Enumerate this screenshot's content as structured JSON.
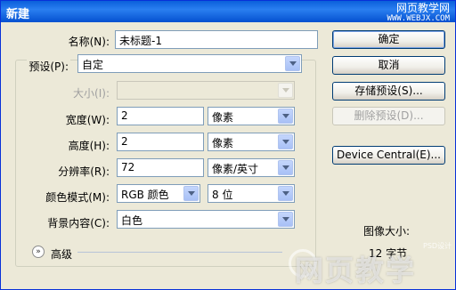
{
  "window": {
    "title": "新建",
    "watermark_top": "网页教学网",
    "watermark_top_sub": "WWW.WEBJX.COM",
    "watermark_bottom": "网页教学",
    "watermark_bottom_small": "PSD设计"
  },
  "form": {
    "name": {
      "label": "名称(N):",
      "value": "未标题-1"
    },
    "preset": {
      "label": "预设(P):",
      "value": "自定"
    },
    "size": {
      "label": "大小(I):",
      "value": ""
    },
    "width": {
      "label": "宽度(W):",
      "value": "2",
      "unit": "像素"
    },
    "height": {
      "label": "高度(H):",
      "value": "2",
      "unit": "像素"
    },
    "resolution": {
      "label": "分辨率(R):",
      "value": "72",
      "unit": "像素/英寸"
    },
    "color_mode": {
      "label": "颜色模式(M):",
      "mode": "RGB 颜色",
      "depth": "8 位"
    },
    "background": {
      "label": "背景内容(C):",
      "value": "白色"
    },
    "advanced": {
      "label": "高级"
    }
  },
  "buttons": {
    "ok": "确定",
    "cancel": "取消",
    "save_preset": "存储预设(S)...",
    "delete_preset": "删除预设(D)...",
    "device_central": "Device Central(E)..."
  },
  "info": {
    "image_size_label": "图像大小:",
    "image_size_value": "12 字节"
  },
  "icons": {
    "collapse": "chevron-double-down-icon",
    "dropdown": "dropdown-arrow-icon"
  }
}
